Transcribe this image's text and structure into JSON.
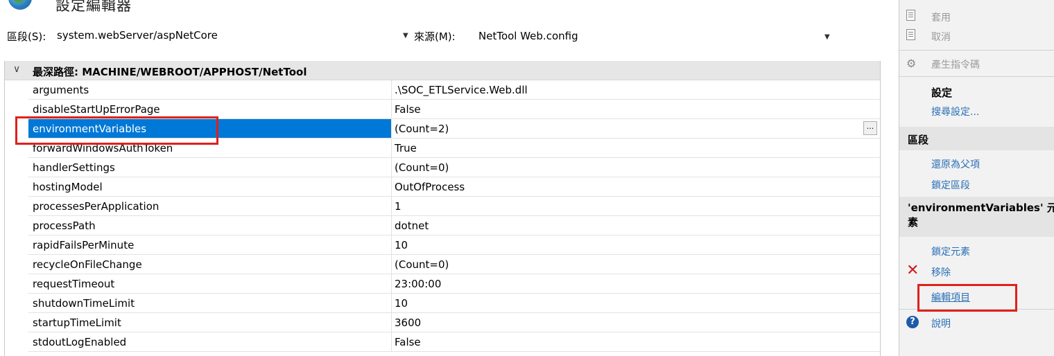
{
  "window": {
    "title": "設定編輯器"
  },
  "toolbar": {
    "section_label": "區段(S):",
    "section_value": "system.webServer/aspNetCore",
    "source_label": "來源(M):",
    "source_value": "NetTool Web.config"
  },
  "grid": {
    "header": "最深路徑: MACHINE/WEBROOT/APPHOST/NetTool",
    "rows": [
      {
        "name": "arguments",
        "value": ".\\SOC_ETLService.Web.dll"
      },
      {
        "name": "disableStartUpErrorPage",
        "value": "False"
      },
      {
        "name": "environmentVariables",
        "value": "(Count=2)"
      },
      {
        "name": "forwardWindowsAuthToken",
        "value": "True"
      },
      {
        "name": "handlerSettings",
        "value": "(Count=0)"
      },
      {
        "name": "hostingModel",
        "value": "OutOfProcess"
      },
      {
        "name": "processesPerApplication",
        "value": "1"
      },
      {
        "name": "processPath",
        "value": "dotnet"
      },
      {
        "name": "rapidFailsPerMinute",
        "value": "10"
      },
      {
        "name": "recycleOnFileChange",
        "value": "(Count=0)"
      },
      {
        "name": "requestTimeout",
        "value": "23:00:00"
      },
      {
        "name": "shutdownTimeLimit",
        "value": "10"
      },
      {
        "name": "startupTimeLimit",
        "value": "3600"
      },
      {
        "name": "stdoutLogEnabled",
        "value": "False"
      }
    ],
    "ellipsis": "..."
  },
  "actions": {
    "apply": "套用",
    "cancel": "取消",
    "generate_script": "產生指令碼",
    "settings_header": "設定",
    "search_settings": "搜尋設定...",
    "section_header": "區段",
    "revert_to_parent": "還原為父項",
    "lock_section": "鎖定區段",
    "element_header_1": "'environmentVariables' 元",
    "element_header_2": "素",
    "lock_element": "鎖定元素",
    "remove": "移除",
    "edit_items": "編輯項目",
    "help": "說明"
  },
  "icons": {
    "title": "globe-icon",
    "apply": "document-check-icon",
    "cancel": "document-x-icon",
    "generate_script": "gear-script-icon",
    "remove": "red-x-icon",
    "help": "help-icon"
  }
}
